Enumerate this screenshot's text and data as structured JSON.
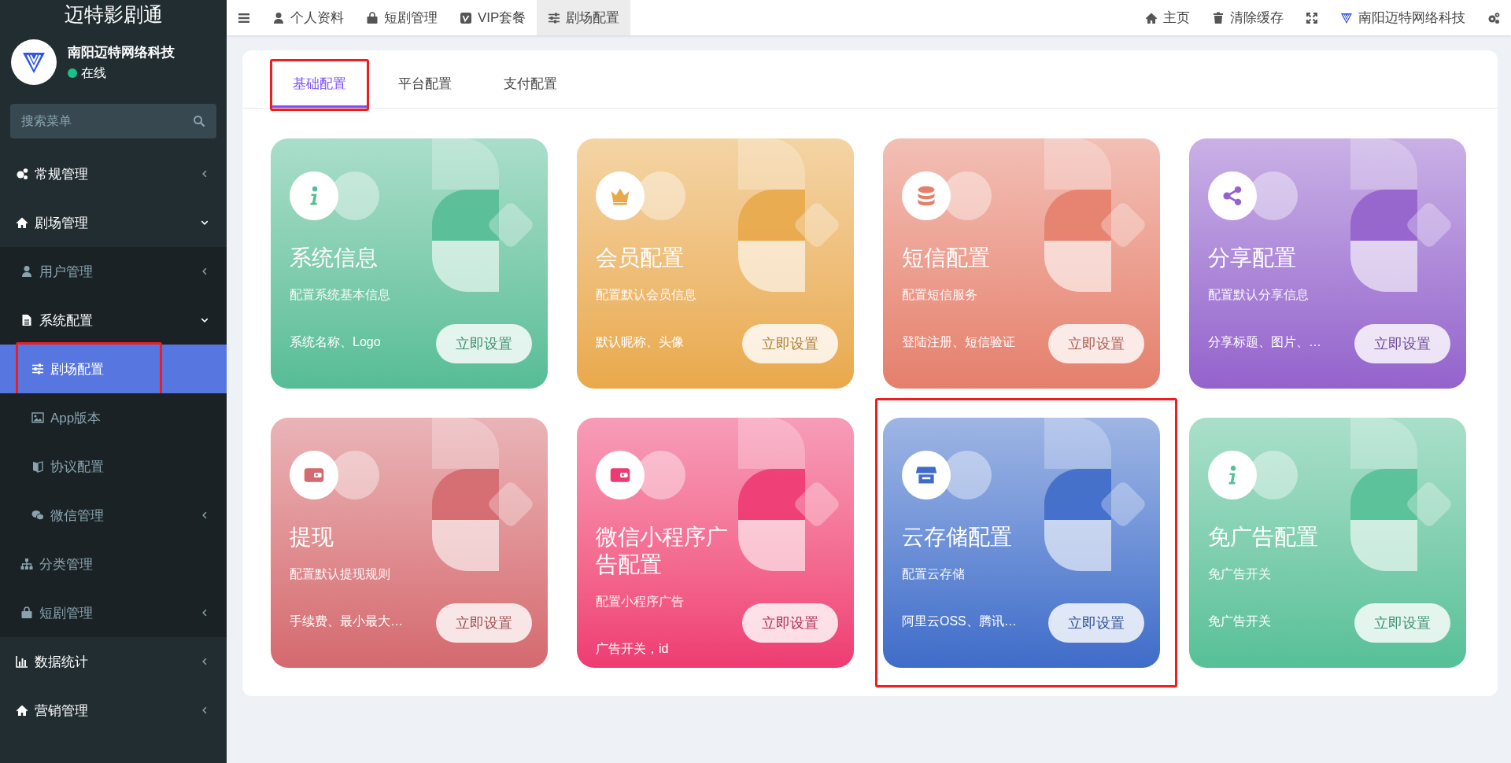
{
  "sidebar": {
    "title": "迈特影剧通",
    "user": {
      "name": "南阳迈特网络科技",
      "status": "在线"
    },
    "search": {
      "placeholder": "搜索菜单"
    },
    "items": [
      {
        "label": "常规管理",
        "expanded": false,
        "selected": false,
        "highlighted": false
      },
      {
        "label": "剧场管理",
        "expanded": true,
        "selected": false,
        "highlighted": false,
        "children": [
          {
            "label": "用户管理",
            "expanded": false,
            "selected": false,
            "highlighted": false
          },
          {
            "label": "系统配置",
            "expanded": true,
            "selected": false,
            "highlighted": false,
            "children": [
              {
                "label": "剧场配置",
                "selected": true,
                "highlighted": true
              },
              {
                "label": "App版本",
                "selected": false,
                "highlighted": false
              },
              {
                "label": "协议配置",
                "selected": false,
                "highlighted": false
              },
              {
                "label": "微信管理",
                "expanded": false,
                "selected": false,
                "highlighted": false
              }
            ]
          },
          {
            "label": "分类管理",
            "selected": false,
            "highlighted": false
          },
          {
            "label": "短剧管理",
            "expanded": false,
            "selected": false,
            "highlighted": false
          }
        ]
      },
      {
        "label": "数据统计",
        "expanded": false,
        "selected": false,
        "highlighted": false
      },
      {
        "label": "营销管理",
        "expanded": false,
        "selected": false,
        "highlighted": false
      }
    ]
  },
  "topbar": {
    "tabs": [
      {
        "label": "个人资料",
        "selected": false
      },
      {
        "label": "短剧管理",
        "selected": false
      },
      {
        "label": "VIP套餐",
        "selected": false
      },
      {
        "label": "剧场配置",
        "selected": true
      }
    ],
    "actions": [
      {
        "kind": "home",
        "label": "主页"
      },
      {
        "kind": "trash",
        "label": "清除缓存"
      },
      {
        "kind": "fullscreen"
      },
      {
        "kind": "brand",
        "label": "南阳迈特网络科技"
      },
      {
        "kind": "settings"
      }
    ]
  },
  "tabs": [
    {
      "label": "基础配置",
      "selected": true,
      "highlighted": true
    },
    {
      "label": "平台配置",
      "selected": false,
      "highlighted": false
    },
    {
      "label": "支付配置",
      "selected": false,
      "highlighted": false
    }
  ],
  "cards": [
    {
      "title": "系统信息",
      "description": "配置系统基本信息",
      "detail": "系统名称、Logo",
      "button": "立即设置",
      "color": "#55bd96",
      "highlighted": false
    },
    {
      "title": "会员配置",
      "description": "配置默认会员信息",
      "detail": "默认昵称、头像",
      "button": "立即设置",
      "color": "#e9a94a",
      "highlighted": false
    },
    {
      "title": "短信配置",
      "description": "配置短信服务",
      "detail": "登陆注册、短信验证",
      "button": "立即设置",
      "color": "#e57f6c",
      "highlighted": false
    },
    {
      "title": "分享配置",
      "description": "配置默认分享信息",
      "detail": "分享标题、图片、…",
      "button": "立即设置",
      "color": "#9462cc",
      "highlighted": false
    },
    {
      "title": "提现",
      "description": "配置默认提现规则",
      "detail": "手续费、最小最大…",
      "button": "立即设置",
      "color": "#d4696f",
      "highlighted": false
    },
    {
      "title": "微信小程序广告配置",
      "description": "配置小程序广告",
      "detail": "广告开关，id",
      "button": "立即设置",
      "color": "#ee3a72",
      "highlighted": false
    },
    {
      "title": "云存储配置",
      "description": "配置云存储",
      "detail": "阿里云OSS、腾讯…",
      "button": "立即设置",
      "color": "#3f6cc9",
      "highlighted": true
    },
    {
      "title": "免广告配置",
      "description": "免广告开关",
      "detail": "免广告开关",
      "button": "立即设置",
      "color": "#55c097",
      "highlighted": false
    }
  ]
}
